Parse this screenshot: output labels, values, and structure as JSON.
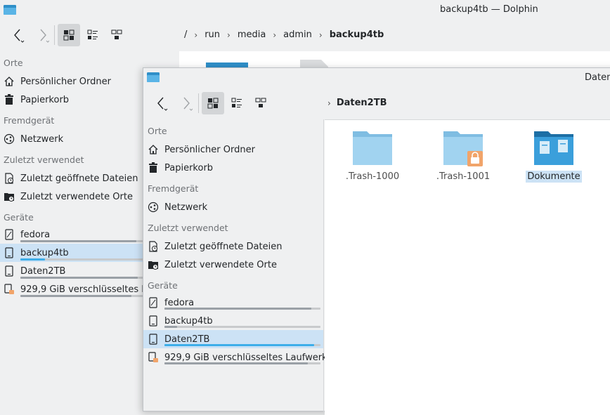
{
  "back_window": {
    "title": "backup4tb — Dolphin",
    "breadcrumb": [
      "/",
      "run",
      "media",
      "admin",
      "backup4tb"
    ],
    "sidebar": {
      "sections": [
        {
          "heading": "Orte",
          "items": [
            {
              "label": "Persönlicher Ordner",
              "icon": "home-icon"
            },
            {
              "label": "Papierkorb",
              "icon": "trash-icon"
            }
          ]
        },
        {
          "heading": "Fremdgerät",
          "items": [
            {
              "label": "Netzwerk",
              "icon": "network-icon"
            }
          ]
        },
        {
          "heading": "Zuletzt verwendet",
          "items": [
            {
              "label": "Zuletzt geöffnete Dateien",
              "icon": "recent-files-icon"
            },
            {
              "label": "Zuletzt verwendete Orte",
              "icon": "recent-places-icon"
            }
          ]
        },
        {
          "heading": "Geräte",
          "items": [
            {
              "label": "fedora",
              "icon": "drive-icon",
              "usage": 0.94
            },
            {
              "label": "backup4tb",
              "icon": "drive-icon",
              "usage": 0.2,
              "selected": true
            },
            {
              "label": "Daten2TB",
              "icon": "drive-icon",
              "usage": 0.95
            },
            {
              "label": "929,9 GiB verschlüsseltes Laufwerk",
              "icon": "encrypted-drive-icon",
              "usage": 0.9
            }
          ]
        }
      ]
    }
  },
  "front_window": {
    "title": "Daten",
    "breadcrumb": [
      "Daten2TB"
    ],
    "sidebar": {
      "sections": [
        {
          "heading": "Orte",
          "items": [
            {
              "label": "Persönlicher Ordner"
            },
            {
              "label": "Papierkorb"
            }
          ]
        },
        {
          "heading": "Fremdgerät",
          "items": [
            {
              "label": "Netzwerk"
            }
          ]
        },
        {
          "heading": "Zuletzt verwendet",
          "items": [
            {
              "label": "Zuletzt geöffnete Dateien"
            },
            {
              "label": "Zuletzt verwendete Orte"
            }
          ]
        },
        {
          "heading": "Geräte",
          "items": [
            {
              "label": "fedora",
              "usage": 0.94
            },
            {
              "label": "backup4tb",
              "usage": 0.08
            },
            {
              "label": "Daten2TB",
              "usage": 0.96,
              "selected": true
            },
            {
              "label": "929,9 GiB verschlüsseltes Laufwerk",
              "usage": 0.92
            }
          ]
        }
      ]
    },
    "files": [
      {
        "name": ".Trash-1000",
        "icon": "folder-icon"
      },
      {
        "name": ".Trash-1001",
        "icon": "locked-folder-icon"
      },
      {
        "name": "Dokumente",
        "icon": "documents-folder-icon",
        "selected": true
      }
    ]
  },
  "colors": {
    "accent": "#3daee9",
    "selection": "#cce2f5",
    "folder_light": "#a1d3f0",
    "folder_dark": "#2f8fc8",
    "lock": "#f1a46a"
  }
}
